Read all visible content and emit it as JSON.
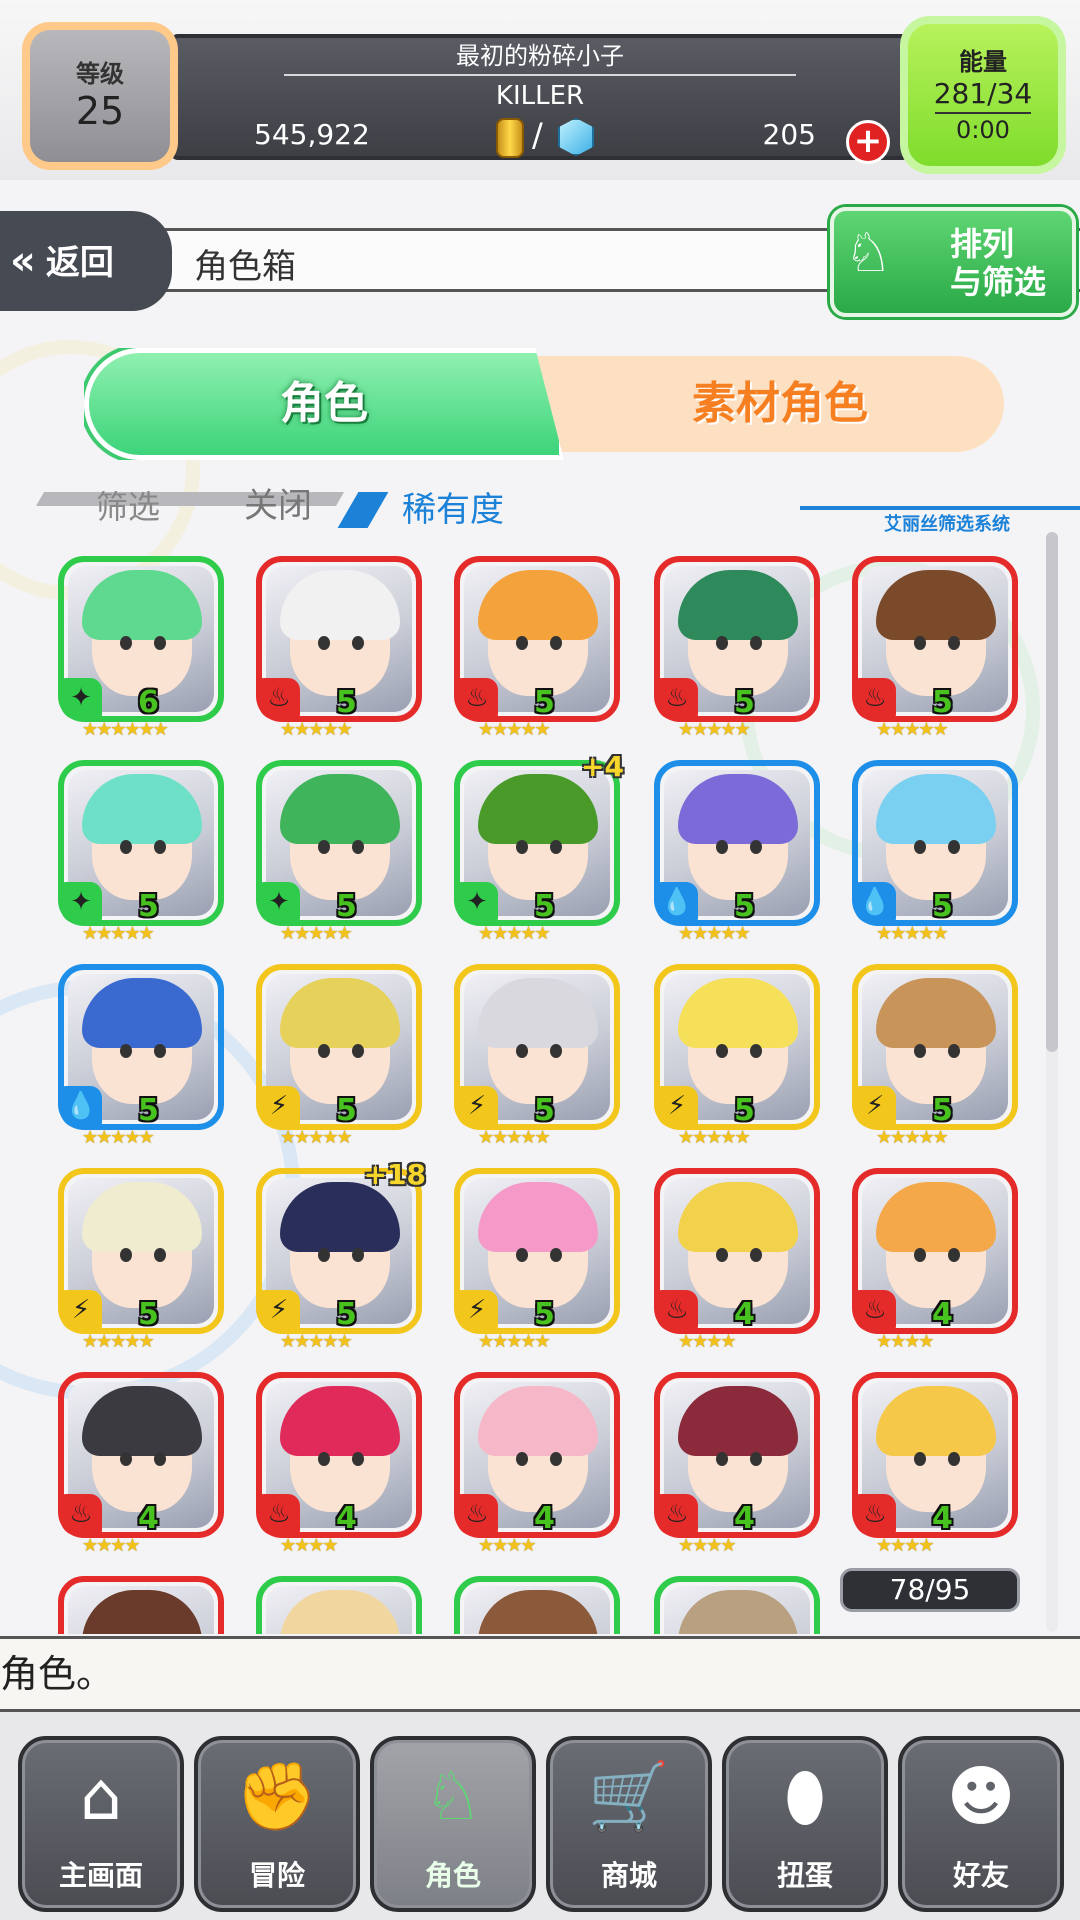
{
  "status": {
    "level_label": "等级",
    "level_value": "25",
    "player_title": "最初的粉碎小子",
    "player_name": "KILLER",
    "gold": "545,922",
    "currency_separator": "/",
    "stones": "205",
    "energy_label": "能量",
    "energy_value": "281/34",
    "energy_timer": "0:00"
  },
  "nav": {
    "back_label": "返回",
    "page_title": "角色箱",
    "sort_line1": "排列",
    "sort_line2": "与筛选"
  },
  "tabs": {
    "characters": "角色",
    "materials": "素材角色"
  },
  "filter": {
    "filter_label": "筛选",
    "off_label": "关闭",
    "rarity_label": "稀有度",
    "system_label": "艾丽丝筛选系统"
  },
  "grid": {
    "count": "78/95",
    "cards": [
      {
        "element": "wood",
        "border": "#2ecc4a",
        "level": "6",
        "stars": 6,
        "plus": "",
        "hair": "#5fd98f"
      },
      {
        "element": "fire",
        "border": "#e52a2a",
        "level": "5",
        "stars": 5,
        "plus": "",
        "hair": "#f1f1f1"
      },
      {
        "element": "fire",
        "border": "#e52a2a",
        "level": "5",
        "stars": 5,
        "plus": "",
        "hair": "#f4a23c"
      },
      {
        "element": "fire",
        "border": "#e52a2a",
        "level": "5",
        "stars": 5,
        "plus": "",
        "hair": "#2e8a5a"
      },
      {
        "element": "fire",
        "border": "#e52a2a",
        "level": "5",
        "stars": 5,
        "plus": "",
        "hair": "#7a4a2a"
      },
      {
        "element": "wood",
        "border": "#2ecc4a",
        "level": "5",
        "stars": 5,
        "plus": "",
        "hair": "#6fe0c8"
      },
      {
        "element": "wood",
        "border": "#2ecc4a",
        "level": "5",
        "stars": 5,
        "plus": "",
        "hair": "#3fb45a"
      },
      {
        "element": "wood",
        "border": "#2ecc4a",
        "level": "5",
        "stars": 5,
        "plus": "+4",
        "hair": "#4a9a2a"
      },
      {
        "element": "water",
        "border": "#1e8fe8",
        "level": "5",
        "stars": 5,
        "plus": "",
        "hair": "#7b6ad8"
      },
      {
        "element": "water",
        "border": "#1e8fe8",
        "level": "5",
        "stars": 5,
        "plus": "",
        "hair": "#7ad0f0"
      },
      {
        "element": "water",
        "border": "#1e8fe8",
        "level": "5",
        "stars": 5,
        "plus": "",
        "hair": "#3a6ad0"
      },
      {
        "element": "light",
        "border": "#f2c61a",
        "level": "5",
        "stars": 5,
        "plus": "",
        "hair": "#e6d25a"
      },
      {
        "element": "light",
        "border": "#f2c61a",
        "level": "5",
        "stars": 5,
        "plus": "",
        "hair": "#d8d8de"
      },
      {
        "element": "light",
        "border": "#f2c61a",
        "level": "5",
        "stars": 5,
        "plus": "",
        "hair": "#f6e05a"
      },
      {
        "element": "light",
        "border": "#f2c61a",
        "level": "5",
        "stars": 5,
        "plus": "",
        "hair": "#c8945a"
      },
      {
        "element": "light",
        "border": "#f2c61a",
        "level": "5",
        "stars": 5,
        "plus": "",
        "hair": "#f0ecd0"
      },
      {
        "element": "light",
        "border": "#f2c61a",
        "level": "5",
        "stars": 5,
        "plus": "+18",
        "hair": "#2a2e5a"
      },
      {
        "element": "light",
        "border": "#f2c61a",
        "level": "5",
        "stars": 5,
        "plus": "",
        "hair": "#f59ac8"
      },
      {
        "element": "fire",
        "border": "#e52a2a",
        "level": "4",
        "stars": 4,
        "plus": "",
        "hair": "#f2d24a"
      },
      {
        "element": "fire",
        "border": "#e52a2a",
        "level": "4",
        "stars": 4,
        "plus": "",
        "hair": "#f4a84a"
      },
      {
        "element": "fire",
        "border": "#e52a2a",
        "level": "4",
        "stars": 4,
        "plus": "",
        "hair": "#3a3a40"
      },
      {
        "element": "fire",
        "border": "#e52a2a",
        "level": "4",
        "stars": 4,
        "plus": "",
        "hair": "#e02a5a"
      },
      {
        "element": "fire",
        "border": "#e52a2a",
        "level": "4",
        "stars": 4,
        "plus": "",
        "hair": "#f6b8c8"
      },
      {
        "element": "fire",
        "border": "#e52a2a",
        "level": "4",
        "stars": 4,
        "plus": "",
        "hair": "#8a2a3a"
      },
      {
        "element": "fire",
        "border": "#e52a2a",
        "level": "4",
        "stars": 4,
        "plus": "",
        "hair": "#f6c84a"
      },
      {
        "element": "fire",
        "border": "#e52a2a",
        "level": "",
        "stars": 0,
        "plus": "",
        "hair": "#6a3a2a"
      },
      {
        "element": "wood",
        "border": "#2ecc4a",
        "level": "",
        "stars": 0,
        "plus": "",
        "hair": "#f2d6a0"
      },
      {
        "element": "wood",
        "border": "#2ecc4a",
        "level": "",
        "stars": 0,
        "plus": "",
        "hair": "#8a5a3a"
      },
      {
        "element": "wood",
        "border": "#2ecc4a",
        "level": "",
        "stars": 0,
        "plus": "",
        "hair": "#b8a080"
      }
    ]
  },
  "message": "角色。",
  "bottom_nav": [
    {
      "label": "主画面",
      "icon": "home-icon",
      "active": false
    },
    {
      "label": "冒险",
      "icon": "handshake-icon",
      "active": false
    },
    {
      "label": "角色",
      "icon": "rabbit-icon",
      "active": true
    },
    {
      "label": "商城",
      "icon": "cart-icon",
      "active": false
    },
    {
      "label": "扭蛋",
      "icon": "egg-icon",
      "active": false
    },
    {
      "label": "好友",
      "icon": "friends-icon",
      "active": false
    }
  ],
  "colors": {
    "wood": "#2ecc4a",
    "fire": "#e52a2a",
    "water": "#1e8fe8",
    "light": "#f2c61a",
    "accent_green": "#3dd47a",
    "accent_orange": "#f67f22"
  }
}
